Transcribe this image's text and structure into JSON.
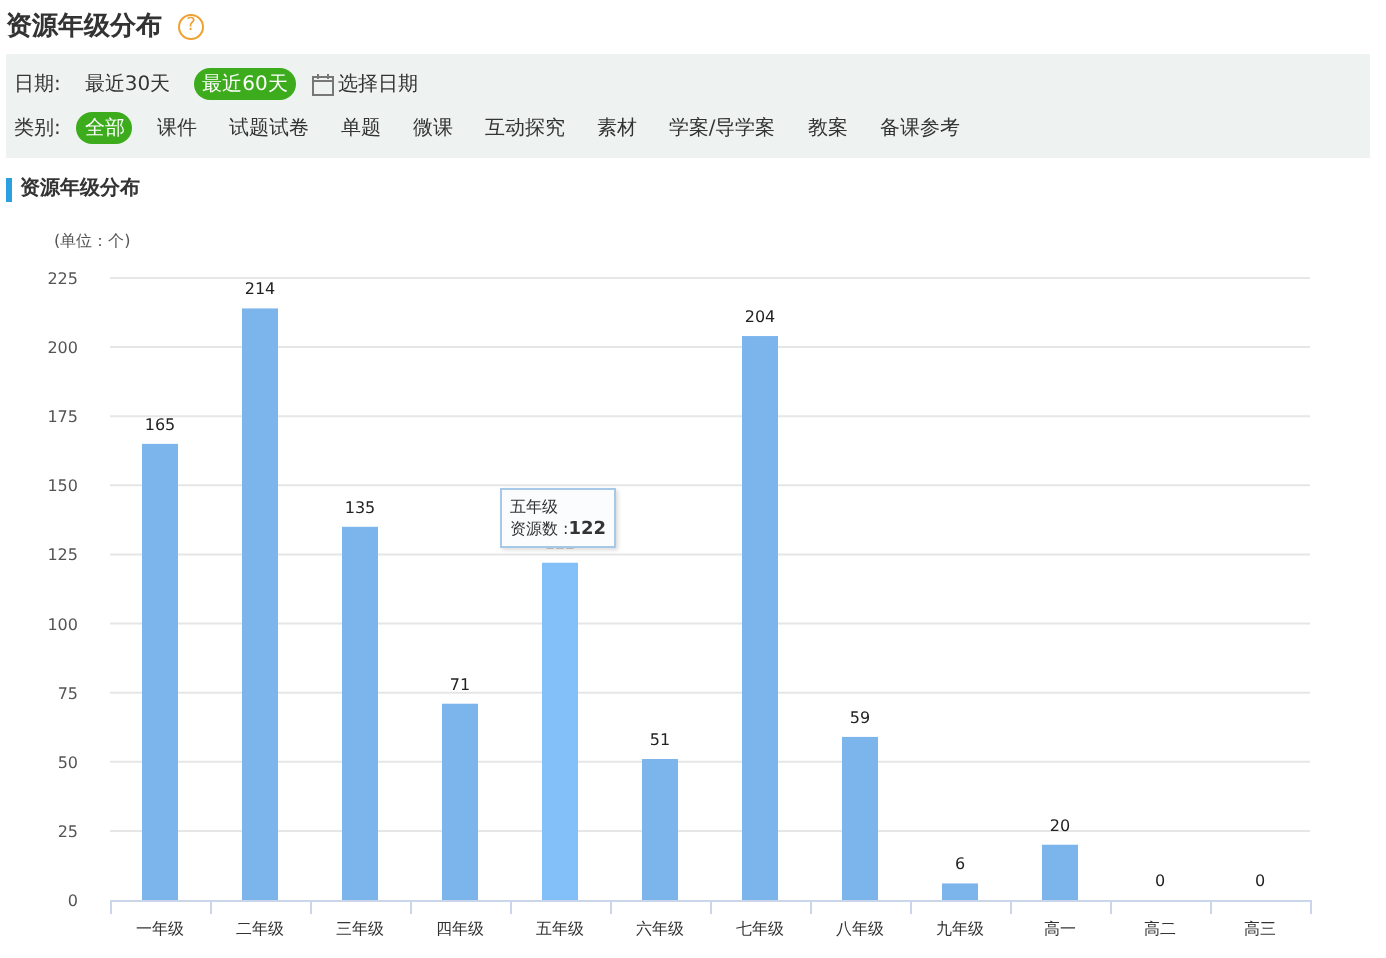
{
  "title": "资源年级分布",
  "help_icon": "?",
  "date_filter": {
    "label": "日期:",
    "options": [
      {
        "label": "最近30天",
        "selected": false
      },
      {
        "label": "最近60天",
        "selected": true
      }
    ],
    "picker": "选择日期"
  },
  "category_filter": {
    "label": "类别:",
    "options": [
      {
        "label": "全部",
        "selected": true
      },
      {
        "label": "课件",
        "selected": false
      },
      {
        "label": "试题试卷",
        "selected": false
      },
      {
        "label": "单题",
        "selected": false
      },
      {
        "label": "微课",
        "selected": false
      },
      {
        "label": "互动探究",
        "selected": false
      },
      {
        "label": "素材",
        "selected": false
      },
      {
        "label": "学案/导学案",
        "selected": false
      },
      {
        "label": "教案",
        "selected": false
      },
      {
        "label": "备课参考",
        "selected": false
      }
    ]
  },
  "section_title": "资源年级分布",
  "chart": {
    "unit": "(单位：个)",
    "hovered": [
      false,
      false,
      false,
      false,
      true,
      false,
      false,
      false,
      false,
      false,
      false,
      false
    ],
    "tooltip": {
      "title": "五年级",
      "separator": " :",
      "value": "122"
    },
    "chart_data": {
      "type": "bar",
      "categories": [
        "一年级",
        "二年级",
        "三年级",
        "四年级",
        "五年级",
        "六年级",
        "七年级",
        "八年级",
        "九年级",
        "高一",
        "高二",
        "高三"
      ],
      "series": [
        {
          "name": "资源数",
          "color": "#7cb5ec",
          "values": [
            165,
            214,
            135,
            71,
            122,
            51,
            204,
            59,
            6,
            20,
            0,
            0
          ]
        }
      ],
      "grid": true,
      "ylim": [
        0,
        225
      ],
      "yticks": [
        0,
        25,
        50,
        75,
        100,
        125,
        150,
        175,
        200,
        225
      ],
      "data_labels": true
    }
  }
}
